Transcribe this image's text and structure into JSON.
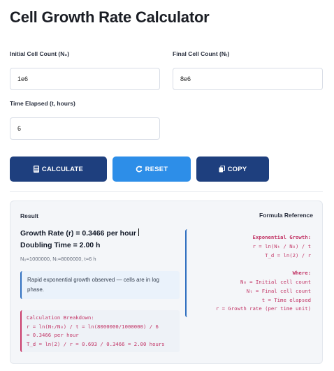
{
  "page": {
    "title": "Cell Growth Rate Calculator"
  },
  "form": {
    "initial_label": "Initial Cell Count (N₀)",
    "initial_value": "1e6",
    "final_label": "Final Cell Count (Nₜ)",
    "final_value": "8e6",
    "time_label": "Time Elapsed (t, hours)",
    "time_value": "6"
  },
  "buttons": {
    "calculate": "CALCULATE",
    "reset": "RESET",
    "copy": "COPY"
  },
  "colors": {
    "primary": "#1e3f7e",
    "reset": "#2d8ee8",
    "formula": "#c23566"
  },
  "icons": {
    "calculate": "calculator-icon",
    "reset": "refresh-icon",
    "copy": "copy-icon"
  },
  "result": {
    "heading": "Result",
    "formula_heading": "Formula Reference",
    "growth_rate": "Growth Rate (r) = 0.3466 per hour",
    "doubling_time": "Doubling Time = 2.00 h",
    "params": "N₀=1000000, Nₜ=8000000, t=6 h",
    "note": "Rapid exponential growth observed — cells are in log phase.",
    "breakdown_title": "Calculation Breakdown:",
    "breakdown_line1": "r = ln(Nₜ/N₀) / t = ln(8000000/1000000) / 6",
    "breakdown_line2": "= 0.3466 per hour",
    "breakdown_line3": "T_d = ln(2) / r = 0.693 / 0.3466 = 2.00 hours"
  },
  "formula": {
    "title": "Exponential Growth:",
    "eq1": "r = ln(Nₜ / N₀) / t",
    "eq2": "T_d = ln(2) / r",
    "where": "Where:",
    "def1": "N₀ = Initial cell count",
    "def2": "Nₜ = Final cell count",
    "def3": "t = Time elapsed",
    "def4": "r = Growth rate (per time unit)"
  }
}
